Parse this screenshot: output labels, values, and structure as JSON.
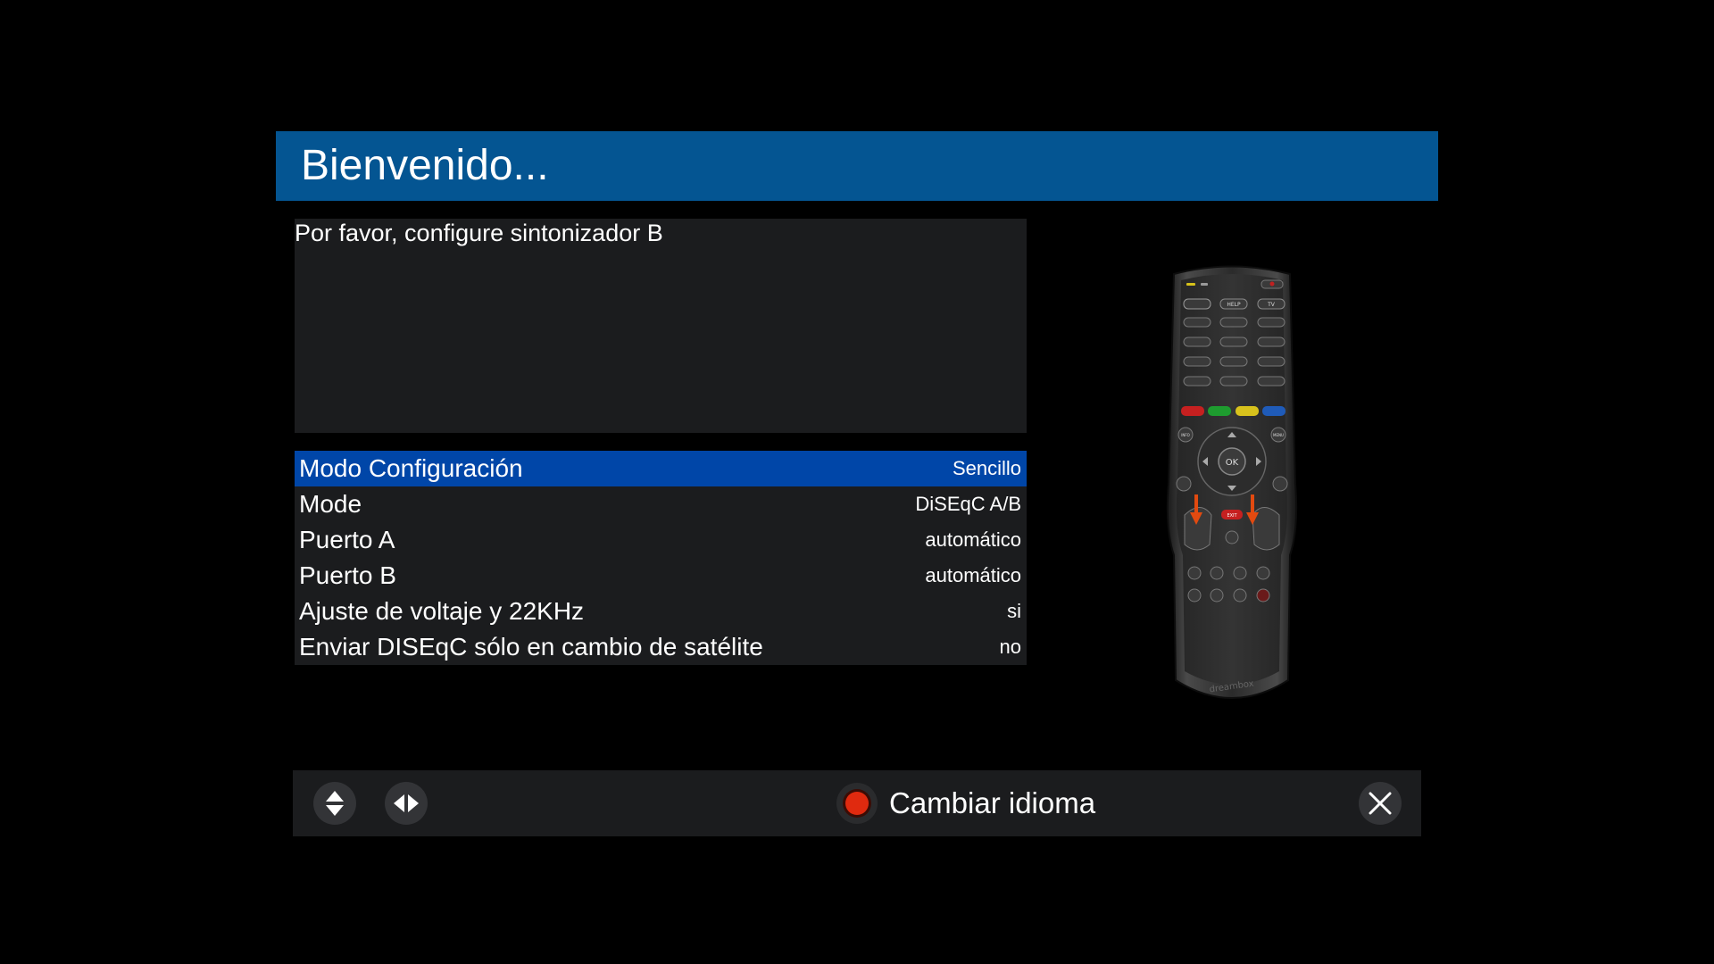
{
  "header": {
    "title": "Bienvenido..."
  },
  "info": {
    "message": "Por favor, configure sintonizador B"
  },
  "config": {
    "rows": [
      {
        "label": "Modo Configuración",
        "value": "Sencillo",
        "selected": true
      },
      {
        "label": "Mode",
        "value": "DiSEqC A/B",
        "selected": false
      },
      {
        "label": "Puerto A",
        "value": "automático",
        "selected": false
      },
      {
        "label": "Puerto B",
        "value": "automático",
        "selected": false
      },
      {
        "label": "Ajuste de voltaje y 22KHz",
        "value": "si",
        "selected": false
      },
      {
        "label": "Enviar DISEqC sólo en cambio de satélite",
        "value": "no",
        "selected": false
      }
    ]
  },
  "remote": {
    "buttons": {
      "help": "HELP",
      "tv": "TV",
      "ok": "OK",
      "exit": "EXIT",
      "info": "INFO",
      "menu": "MENU"
    },
    "brand": "dreambox"
  },
  "footer": {
    "up_down_icon": "up-down-arrows-icon",
    "left_right_icon": "left-right-arrows-icon",
    "red_button_label": "Cambiar idioma",
    "close_icon": "close-icon"
  },
  "colors": {
    "title_bar": "#045592",
    "selected_row": "#0046a8",
    "panel": "#1b1c1e",
    "red_key": "#e02a0f"
  }
}
